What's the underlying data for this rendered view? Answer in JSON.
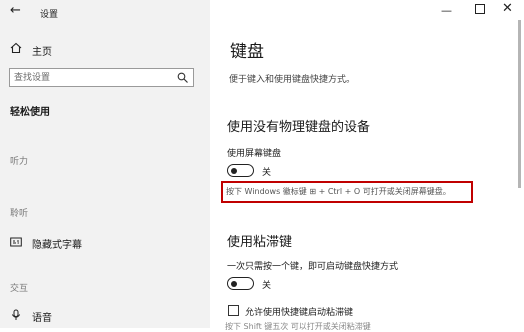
{
  "window": {
    "title": "设置",
    "back_icon": "arrow-left",
    "minimize_icon": "—",
    "close_icon": "✕"
  },
  "sidebar": {
    "home_label": "主页",
    "search_placeholder": "查找设置",
    "section_title": "轻松使用",
    "groups": [
      {
        "label": "听力"
      },
      {
        "label": "聆听",
        "items": [
          {
            "icon": "captions-icon",
            "label": "隐藏式字幕"
          }
        ]
      },
      {
        "label": "交互",
        "items": [
          {
            "icon": "microphone-icon",
            "label": "语音"
          }
        ]
      }
    ]
  },
  "main": {
    "title": "键盘",
    "subtitle": "便于键入和使用键盘快捷方式。",
    "sections": [
      {
        "heading": "使用没有物理键盘的设备",
        "setting_label": "使用屏幕键盘",
        "toggle_state": "关",
        "hint": "按下 Windows 徽标键 ⊞ + Ctrl + O 可打开或关闭屏幕键盘。"
      },
      {
        "heading": "使用粘滞键",
        "setting_label": "一次只需按一个键，即可启动键盘快捷方式",
        "toggle_state": "关",
        "checkbox_label": "允许使用快捷键启动粘滞键",
        "partial_text": "按下 Shift 键五次 可以打开或关闭粘滞键"
      }
    ]
  },
  "colors": {
    "highlight_border": "#c00000",
    "sidebar_bg": "#f2f2f2"
  }
}
